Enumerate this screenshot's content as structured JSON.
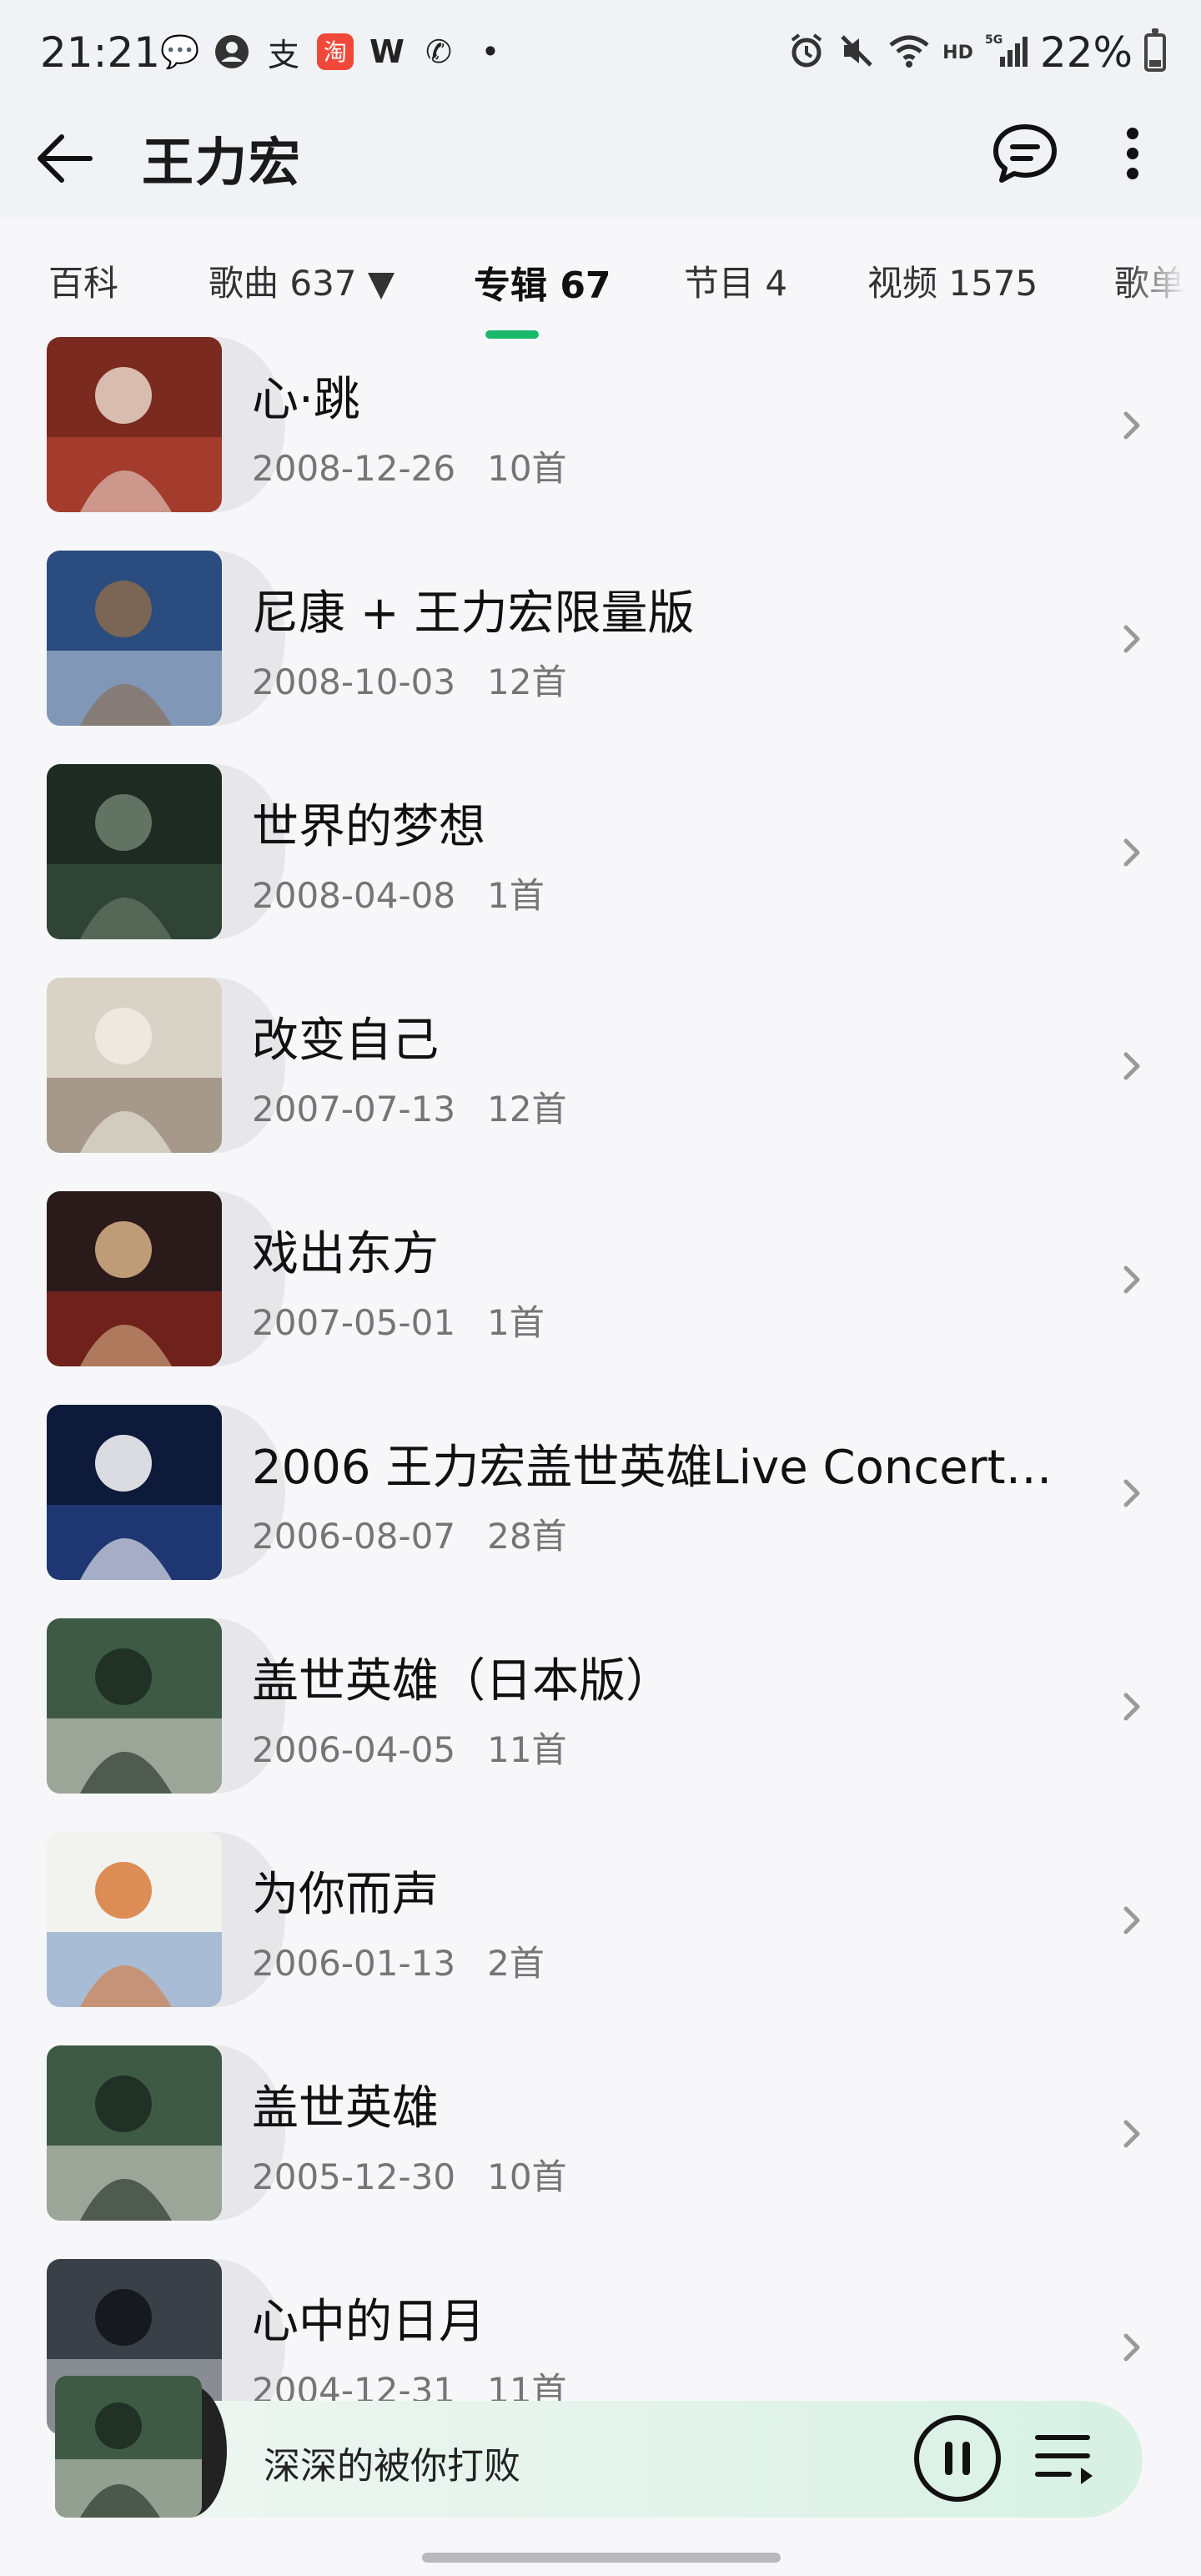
{
  "status_bar": {
    "time": "21:21",
    "battery": "22%",
    "battery_level": 0.22,
    "left_icons": [
      "message-icon",
      "person-icon",
      "alipay-icon",
      "taobao-icon",
      "w-icon",
      "phone-icon",
      "dot-icon"
    ],
    "right_icons": [
      "alarm-icon",
      "mute-icon",
      "wifi-icon",
      "hd-icon",
      "5g-signal-icon"
    ],
    "left_glyphs": [
      "💬",
      "●",
      "支",
      "淘",
      "W",
      "✆",
      "•"
    ],
    "hd_label": "HD",
    "net_label": "5G"
  },
  "header": {
    "title": "王力宏"
  },
  "tabs": [
    {
      "label": "百科"
    },
    {
      "label": "歌曲 637 ▼"
    },
    {
      "label": "专辑 67"
    },
    {
      "label": "节目 4"
    },
    {
      "label": "视频 1575"
    },
    {
      "label": "歌单"
    }
  ],
  "active_tab": 2,
  "albums": [
    {
      "name": "心·跳",
      "date": "2008-12-26",
      "count": "10首",
      "cover_colors": [
        "#7a2a1e",
        "#c44a3a",
        "#e9d6c9"
      ]
    },
    {
      "name": "尼康 + 王力宏限量版",
      "date": "2008-10-03",
      "count": "12首",
      "cover_colors": [
        "#2b4c7e",
        "#c9d6e6",
        "#8a6a4c"
      ]
    },
    {
      "name": "世界的梦想",
      "date": "2008-04-08",
      "count": "1首",
      "cover_colors": [
        "#1d2b22",
        "#3f5a45",
        "#6f7f6f"
      ]
    },
    {
      "name": "改变自己",
      "date": "2007-07-13",
      "count": "12首",
      "cover_colors": [
        "#d9d3c7",
        "#7b6a5a",
        "#f0ece4"
      ]
    },
    {
      "name": "戏出东方",
      "date": "2007-05-01",
      "count": "1首",
      "cover_colors": [
        "#2a1a1a",
        "#a82a1e",
        "#d9b48a"
      ]
    },
    {
      "name": "2006 王力宏盖世英雄Live Concert…",
      "date": "2006-08-07",
      "count": "28首",
      "cover_colors": [
        "#0e1a3a",
        "#2c4fa0",
        "#ffffff"
      ]
    },
    {
      "name": "盖世英雄（日本版）",
      "date": "2006-04-05",
      "count": "11首",
      "cover_colors": [
        "#3e5a45",
        "#e8e4dc",
        "#1c2a20"
      ]
    },
    {
      "name": "为你而声",
      "date": "2006-01-13",
      "count": "2首",
      "cover_colors": [
        "#f2f2ef",
        "#6e8fc0",
        "#d87a3a"
      ]
    },
    {
      "name": "盖世英雄",
      "date": "2005-12-30",
      "count": "10首",
      "cover_colors": [
        "#3e5a45",
        "#e8e4dc",
        "#1c2a20"
      ]
    },
    {
      "name": "心中的日月",
      "date": "2004-12-31",
      "count": "11首",
      "cover_colors": [
        "#3a4048",
        "#c8ccd2",
        "#111418"
      ]
    }
  ],
  "player": {
    "song": "深深的被你打败",
    "cover_colors": [
      "#3e5a45",
      "#e8e4dc",
      "#1c2a20"
    ]
  },
  "colors": {
    "accent": "#19b96b",
    "meta_text": "#757575"
  }
}
